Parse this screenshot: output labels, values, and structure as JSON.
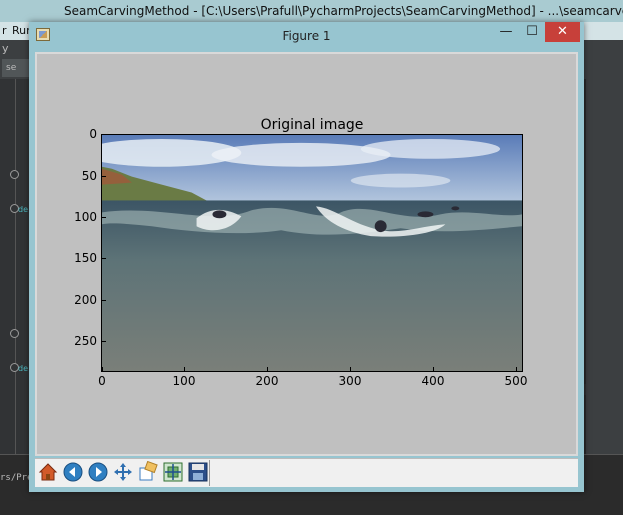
{
  "ide": {
    "title": "SeamCarvingMethod - [C:\\Users\\Prafull\\PycharmProjects\\SeamCarvingMethod] - ...\\seamcarver.py -",
    "menu_r": "r",
    "menu_run": "Run",
    "menu_y": "y",
    "tab_label": "se",
    "gutter_code_1": "de",
    "gutter_code_2": "de",
    "console_text": "rs/Pre"
  },
  "window": {
    "title": "Figure 1",
    "minimize": "—",
    "maximize": "☐",
    "close": "✕"
  },
  "toolbar": {
    "buttons": [
      "home-icon",
      "back-arrow-icon",
      "forward-arrow-icon",
      "pan-icon",
      "zoom-icon",
      "subplots-icon",
      "save-icon"
    ]
  },
  "colors": {
    "window_frame": "#97c5d0",
    "canvas_bg": "#c0c0c0",
    "close_button": "#c7403a"
  },
  "chart_data": {
    "type": "image",
    "title": "Original image",
    "xlim": [
      0,
      512
    ],
    "ylim": [
      288,
      0
    ],
    "x_ticks": [
      "0",
      "100",
      "200",
      "300",
      "400",
      "500"
    ],
    "y_ticks": [
      "0",
      "50",
      "100",
      "150",
      "200",
      "250"
    ],
    "image_description": "ocean-wave-with-surfers"
  }
}
